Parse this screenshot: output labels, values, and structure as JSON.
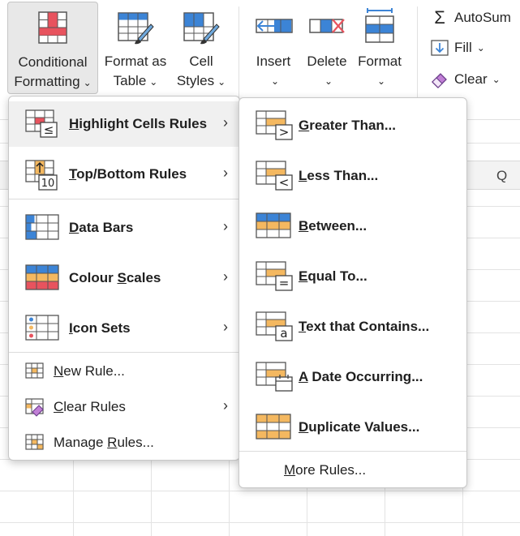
{
  "ribbon": {
    "conditional_formatting": {
      "line1": "Conditional",
      "line2": "Formatting"
    },
    "format_as_table": {
      "line1": "Format as",
      "line2": "Table"
    },
    "cell_styles": {
      "line1": "Cell",
      "line2": "Styles"
    },
    "insert": {
      "label": "Insert"
    },
    "delete": {
      "label": "Delete"
    },
    "format": {
      "label": "Format"
    },
    "autosum": {
      "label": "AutoSum"
    },
    "fill": {
      "label": "Fill"
    },
    "clear": {
      "label": "Clear"
    },
    "chevron": "⌄"
  },
  "sheet": {
    "column_header_partial": "Q"
  },
  "cf_menu": {
    "items": [
      {
        "label_underlined": "H",
        "label_rest": "ighlight Cells Rules",
        "has_submenu": true
      },
      {
        "label_underlined": "T",
        "label_rest": "op/Bottom Rules",
        "has_submenu": true
      },
      {
        "label_underlined": "D",
        "label_rest": "ata Bars",
        "has_submenu": true
      },
      {
        "label_pre": "Colour ",
        "label_underlined": "S",
        "label_rest": "cales",
        "has_submenu": true
      },
      {
        "label_underlined": "I",
        "label_rest": "con Sets",
        "has_submenu": true
      }
    ],
    "actions": [
      {
        "label_underlined": "N",
        "label_rest": "ew Rule...",
        "has_submenu": false
      },
      {
        "label_underlined": "C",
        "label_rest": "lear Rules",
        "has_submenu": true
      },
      {
        "label_pre": "Manage ",
        "label_underlined": "R",
        "label_rest": "ules...",
        "has_submenu": false
      }
    ],
    "submenu_arrow": "›"
  },
  "highlight_submenu": {
    "items": [
      {
        "label_underlined": "G",
        "label_rest": "reater Than..."
      },
      {
        "label_underlined": "L",
        "label_rest": "ess Than..."
      },
      {
        "label_underlined": "B",
        "label_rest": "etween..."
      },
      {
        "label_underlined": "E",
        "label_rest": "qual To..."
      },
      {
        "label_underlined": "T",
        "label_rest": "ext that Contains..."
      },
      {
        "label_underlined": "A",
        "label_rest": " Date Occurring..."
      },
      {
        "label_underlined": "D",
        "label_rest": "uplicate Values..."
      }
    ],
    "more": {
      "label_underlined": "M",
      "label_rest": "ore Rules..."
    }
  },
  "colors": {
    "accent_blue": "#3c84d6",
    "highlight_red": "#e8535e",
    "highlight_orange": "#f4b860",
    "menu_hover": "#f0f0f0"
  }
}
